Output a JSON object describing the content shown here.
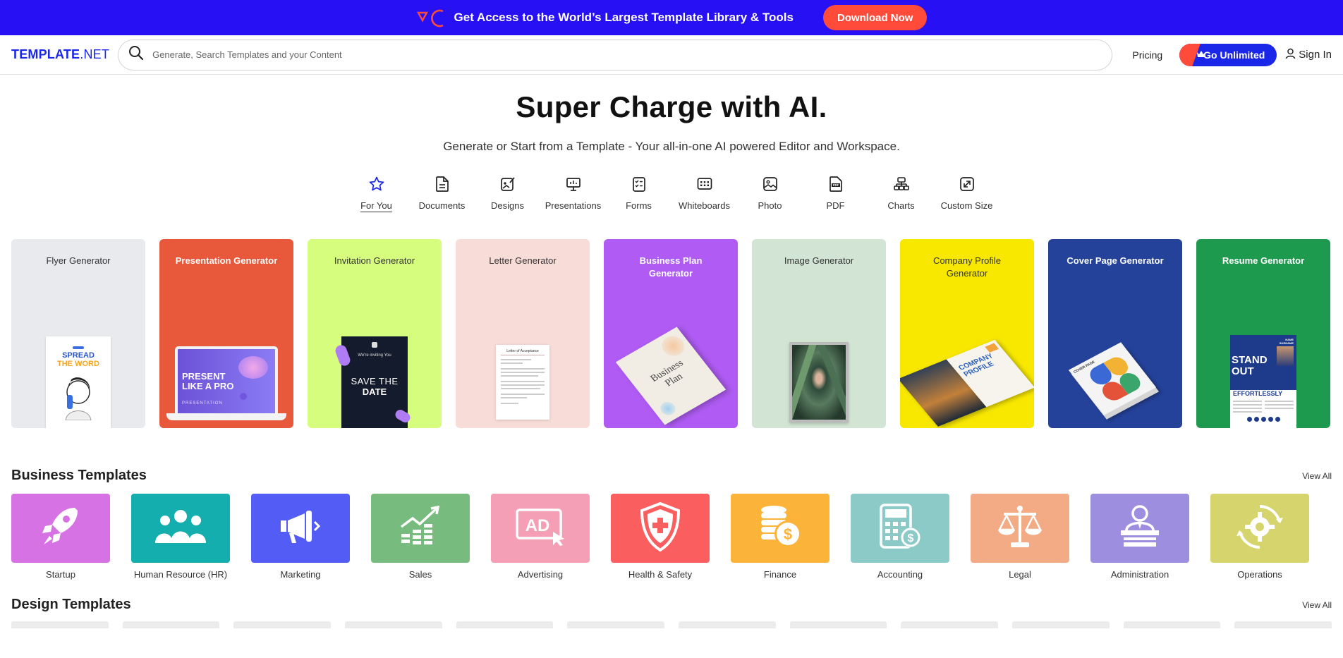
{
  "promo": {
    "text": "Get Access to the World’s Largest Template Library & Tools",
    "button": "Download Now"
  },
  "nav": {
    "brand_main": "TEMPLATE",
    "brand_suffix": ".NET",
    "search_placeholder": "Generate, Search Templates and your Content",
    "pricing": "Pricing",
    "go_unlimited": "Go Unlimited",
    "sign_in": "Sign In"
  },
  "hero": {
    "title": "Super Charge with AI.",
    "subtitle": "Generate or Start from a Template - Your all-in-one AI powered Editor and Workspace."
  },
  "categories": [
    {
      "label": "For You",
      "icon": "star-icon"
    },
    {
      "label": "Documents",
      "icon": "document-icon"
    },
    {
      "label": "Designs",
      "icon": "design-icon"
    },
    {
      "label": "Presentations",
      "icon": "presentation-icon"
    },
    {
      "label": "Forms",
      "icon": "form-icon"
    },
    {
      "label": "Whiteboards",
      "icon": "whiteboard-icon"
    },
    {
      "label": "Photo",
      "icon": "photo-icon"
    },
    {
      "label": "PDF",
      "icon": "pdf-icon"
    },
    {
      "label": "Charts",
      "icon": "chart-icon"
    },
    {
      "label": "Custom Size",
      "icon": "custom-size-icon"
    }
  ],
  "generators": [
    {
      "title": "Flyer Generator",
      "bg": "#e8eaed",
      "art_text": [
        "SPREAD",
        "THE WORD"
      ]
    },
    {
      "title": "Presentation Generator",
      "bg": "#e8583a",
      "art_text": [
        "PRESENT",
        "LIKE A PRO",
        "PRESENTATION"
      ]
    },
    {
      "title": "Invitation Generator",
      "bg": "#d6fd7e",
      "art_text": [
        "We're inviting You",
        "SAVE THE",
        "DATE"
      ]
    },
    {
      "title": "Letter Generator",
      "bg": "#f8dcd8",
      "art_text": [
        "Letter of Acceptance"
      ]
    },
    {
      "title": "Business Plan Generator",
      "bg": "#b05cf4",
      "art_text": [
        "Business",
        "Plan"
      ]
    },
    {
      "title": "Image Generator",
      "bg": "#d2e5d4",
      "art_text": []
    },
    {
      "title": "Company Profile Generator",
      "bg": "#f8e800",
      "art_text": [
        "COMPANY",
        "PROFILE"
      ]
    },
    {
      "title": "Cover Page Generator",
      "bg": "#25429a",
      "art_text": [
        "COVER PAGE"
      ]
    },
    {
      "title": "Resume Generator",
      "bg": "#1d9a4d",
      "art_text": [
        "NAME",
        "SURNAME",
        "STAND",
        "OUT",
        "EFFORTLESSLY"
      ]
    }
  ],
  "business": {
    "title": "Business Templates",
    "view_all": "View All",
    "items": [
      {
        "label": "Startup",
        "bg": "#d672e4",
        "icon": "rocket-icon"
      },
      {
        "label": "Human Resource (HR)",
        "bg": "#14aeae",
        "icon": "people-icon"
      },
      {
        "label": "Marketing",
        "bg": "#545cf6",
        "icon": "megaphone-icon"
      },
      {
        "label": "Sales",
        "bg": "#78bb7f",
        "icon": "growth-chart-icon"
      },
      {
        "label": "Advertising",
        "bg": "#f49fb5",
        "icon": "ad-icon"
      },
      {
        "label": "Health & Safety",
        "bg": "#fb5e5e",
        "icon": "shield-cross-icon"
      },
      {
        "label": "Finance",
        "bg": "#fcb33a",
        "icon": "coins-icon"
      },
      {
        "label": "Accounting",
        "bg": "#8ccac8",
        "icon": "calculator-icon"
      },
      {
        "label": "Legal",
        "bg": "#f3ab85",
        "icon": "scales-icon"
      },
      {
        "label": "Administration",
        "bg": "#9d8ee0",
        "icon": "admin-desk-icon"
      },
      {
        "label": "Operations",
        "bg": "#d6d46c",
        "icon": "gear-cycle-icon"
      }
    ]
  },
  "design": {
    "title": "Design Templates",
    "view_all": "View All"
  }
}
